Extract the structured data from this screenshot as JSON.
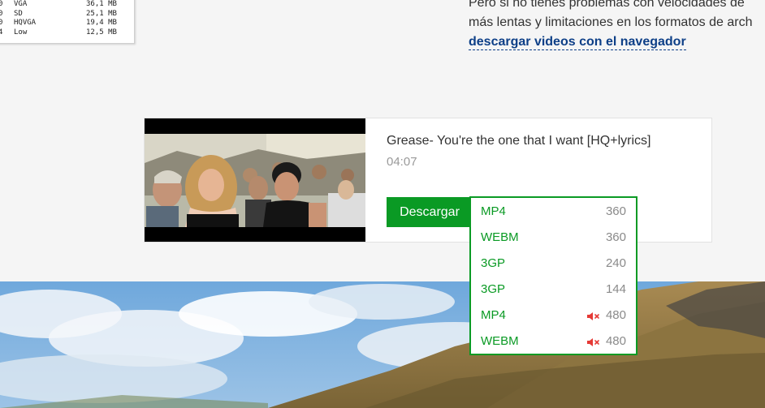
{
  "quality_table": {
    "rows": [
      {
        "n": "0",
        "label": "VGA",
        "size": "36,1 MB"
      },
      {
        "n": "0",
        "label": "SD",
        "size": "25,1 MB"
      },
      {
        "n": "0",
        "label": "HQVGA",
        "size": "19,4 MB"
      },
      {
        "n": "4",
        "label": "Low",
        "size": "12,5 MB"
      }
    ]
  },
  "intro": {
    "line1": "Pero si no tienes problemas con velocidades de",
    "line2": "más lentas y limitaciones en los formatos de arch",
    "link": "descargar videos con el navegador"
  },
  "video": {
    "title": "Grease- You're the one that I want [HQ+lyrics]",
    "duration": "04:07",
    "download_label": "Descargar"
  },
  "formats": [
    {
      "format": "MP4",
      "resolution": "360",
      "muted": false
    },
    {
      "format": "WEBM",
      "resolution": "360",
      "muted": false
    },
    {
      "format": "3GP",
      "resolution": "240",
      "muted": false
    },
    {
      "format": "3GP",
      "resolution": "144",
      "muted": false
    },
    {
      "format": "MP4",
      "resolution": "480",
      "muted": true
    },
    {
      "format": "WEBM",
      "resolution": "480",
      "muted": true
    }
  ],
  "icons": {
    "mute": "speaker-muted-icon"
  },
  "colors": {
    "accent_green": "#0a9a24",
    "link_blue": "#0d3f87",
    "mute_red": "#e53935"
  }
}
